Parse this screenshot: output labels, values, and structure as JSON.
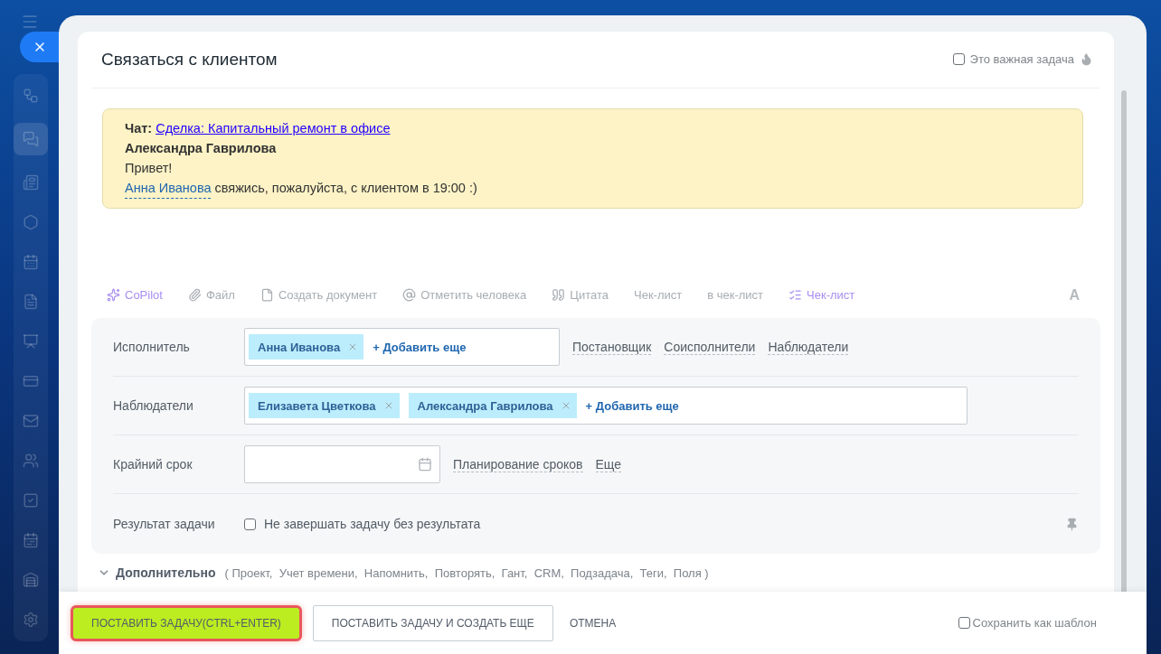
{
  "task": {
    "title": "Связаться с клиентом",
    "important": {
      "label": "Это важная задача",
      "checked": false
    }
  },
  "quote": {
    "chat_label": "Чат:",
    "chat_link": "Сделка: Капитальный ремонт в офисе",
    "author": "Александра Гаврилова",
    "greeting": "Привет!",
    "mention": "Анна Иванова",
    "message": "свяжись, пожалуйста, с клиентом в 19:00 :)"
  },
  "toolbar": [
    {
      "kind": "copilot",
      "label": "CoPilot",
      "accent": true
    },
    {
      "kind": "file",
      "label": "Файл",
      "accent": false
    },
    {
      "kind": "document",
      "label": "Создать документ",
      "accent": false
    },
    {
      "kind": "mention",
      "label": "Отметить человека",
      "accent": false
    },
    {
      "kind": "quote",
      "label": "Цитата",
      "accent": false
    },
    {
      "kind": "plain",
      "label": "Чек-лист",
      "accent": false
    },
    {
      "kind": "plain",
      "label": "в чек-лист",
      "accent": false
    },
    {
      "kind": "checklist",
      "label": "Чек-лист",
      "accent": true
    }
  ],
  "format_button": "A",
  "fields": [
    {
      "kind": "people",
      "label": "Исполнитель",
      "people": [
        "Анна Иванова"
      ],
      "add": "+ Добавить еще",
      "wide": false,
      "links": [
        "Постановщик",
        "Соисполнители",
        "Наблюдатели"
      ]
    },
    {
      "kind": "people",
      "label": "Наблюдатели",
      "people": [
        "Елизавета Цветкова",
        "Александра Гаврилова"
      ],
      "add": "+ Добавить еще",
      "wide": true
    },
    {
      "kind": "date",
      "label": "Крайний срок",
      "links": [
        "Планирование сроков",
        "Еще"
      ]
    },
    {
      "kind": "check",
      "label": "Результат задачи",
      "check_label": "Не завершать задачу без результата",
      "checked": false
    }
  ],
  "more": {
    "label": "Дополнительно",
    "items": "( Проект,  Учет времени,  Напомнить,  Повторять,  Гант,  CRM,  Подзадача,  Теги,  Поля )"
  },
  "footer": {
    "primary": "ПОСТАВИТЬ ЗАДАЧУ(CTRL+ENTER)",
    "secondary": "ПОСТАВИТЬ ЗАДАЧУ И СОЗДАТЬ ЕЩЕ",
    "cancel": "ОТМЕНА",
    "template": {
      "label": "Сохранить как шаблон",
      "checked": false
    }
  }
}
